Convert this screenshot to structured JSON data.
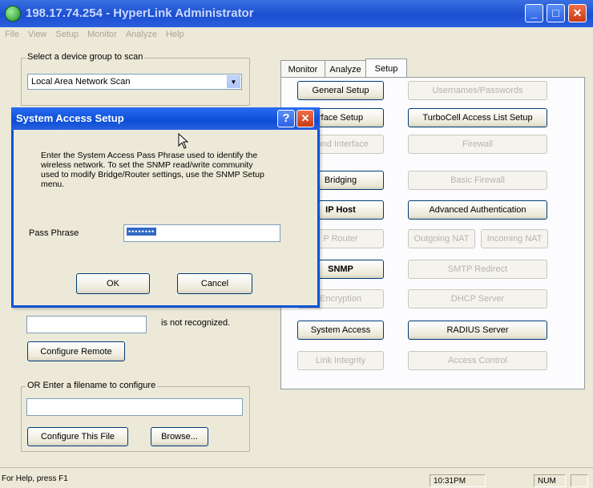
{
  "window": {
    "title": "198.17.74.254 - HyperLink Administrator",
    "menu": [
      "File",
      "View",
      "Setup",
      "Monitor",
      "Analyze",
      "Help"
    ]
  },
  "left": {
    "device_group_label": "Select a device group to scan",
    "device_group_value": "Local Area Network Scan",
    "not_recognized_text": "is not recognized.",
    "configure_remote_label": "Configure Remote",
    "filename_group_label": "OR Enter a filename to configure",
    "configure_file_label": "Configure This File",
    "browse_label": "Browse..."
  },
  "tabs": [
    "Monitor",
    "Analyze",
    "Setup"
  ],
  "active_tab": "Setup",
  "setup_buttons": {
    "general_setup": "General Setup",
    "usernames_passwords": "Usernames/Passwords",
    "interface_setup": "rface Setup",
    "turbocell_access_list": "TurboCell Access List Setup",
    "second_interface": "cond Interface",
    "firewall": "Firewall",
    "bridging": "Bridging",
    "basic_firewall": "Basic Firewall",
    "ip_host": "IP Host",
    "advanced_auth": "Advanced Authentication",
    "ip_router": "P Router",
    "outgoing_nat": "Outgoing NAT",
    "incoming_nat": "Incoming NAT",
    "snmp": "SNMP",
    "smtp_redirect": "SMTP Redirect",
    "encryption": "Encryption",
    "dhcp_server": "DHCP Server",
    "system_access": "System Access",
    "radius_server": "RADIUS Server",
    "link_integrity": "Link Integrity",
    "access_control": "Access Control"
  },
  "dialog": {
    "title": "System Access Setup",
    "message": "Enter the System Access Pass Phrase used to identify the wireless network. To set the SNMP read/write community used to modify Bridge/Router settings, use the SNMP Setup menu.",
    "pass_phrase_label": "Pass Phrase",
    "pass_phrase_value": "••••••••",
    "ok_label": "OK",
    "cancel_label": "Cancel",
    "help_glyph": "?",
    "close_glyph": "✕"
  },
  "status": {
    "help_text": "For Help, press F1",
    "time": "10:31PM",
    "num": "NUM"
  },
  "colors": {
    "titlebar": "#1c4fd0",
    "face": "#ece9d8",
    "dialog_border": "#0a53d6"
  }
}
